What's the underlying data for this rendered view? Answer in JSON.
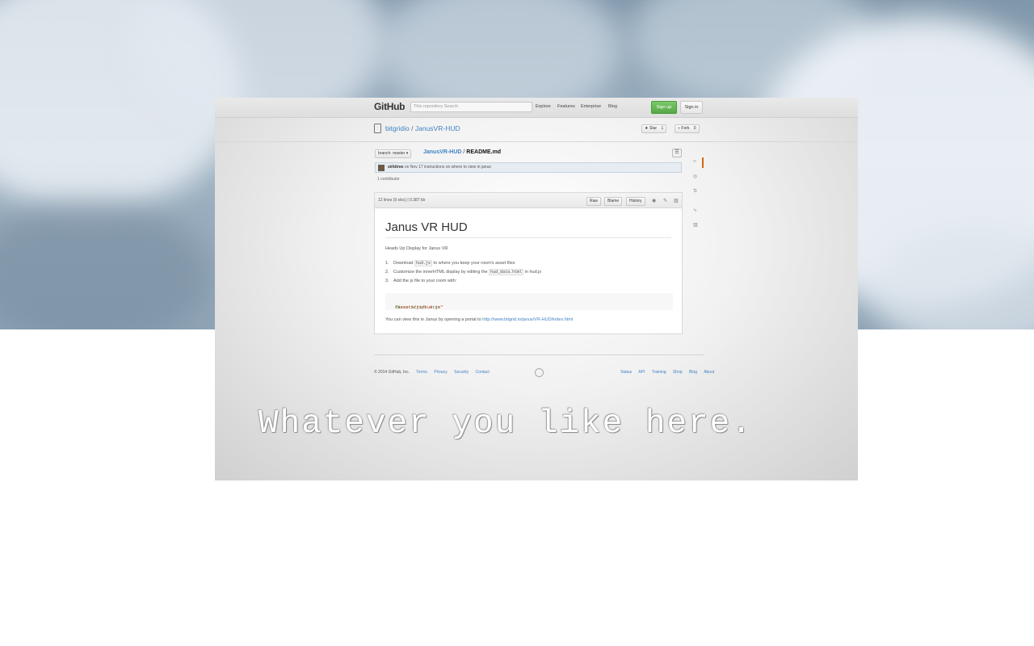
{
  "github": {
    "logo": "GitHub",
    "search_placeholder": "This repository  Search",
    "nav": [
      "Explore",
      "Features",
      "Enterprise",
      "Blog"
    ],
    "signup": "Sign up",
    "signin": "Sign in"
  },
  "repo": {
    "owner": "bitgridio",
    "separator": " / ",
    "name": "JanusVR-HUD",
    "star_label": "★ Star",
    "star_count": "1",
    "fork_label": "⑂ Fork",
    "fork_count": "0"
  },
  "file": {
    "branch_label": "branch: master ▾",
    "crumb_repo": "JanusVR-HUD",
    "crumb_sep": " / ",
    "crumb_file": "README.md",
    "commit_author": "sirkitree",
    "commit_text": "on Nov 17 instructions on where to view in janus",
    "contributors": "1 contributor",
    "info": "12 lines (9 sloc)  |  0.387 kb",
    "buttons": [
      "Raw",
      "Blame",
      "History"
    ]
  },
  "readme": {
    "title": "Janus VR HUD",
    "intro": "Heads Up Display for Janus VR",
    "steps": [
      {
        "num": "1.",
        "pre": "Download ",
        "code": "hud.js",
        "post": " to where you keep your room's asset files"
      },
      {
        "num": "2.",
        "pre": "Customize the innerHTML display by editing the ",
        "code": "hud_data.html",
        "post": " in hud.js"
      },
      {
        "num": "3.",
        "pre": "Add the js file to your room with:",
        "code": "",
        "post": ""
      }
    ],
    "code_tag_open": "<AssetScript src=",
    "code_src": "\"assets/js/hud.js\"",
    "code_tag_close": " />",
    "view_text": "You can view this in Janus by opening a portal to ",
    "view_link": "http://www.bitgrid.io/janus/VR-HUD/index.html"
  },
  "footer": {
    "copyright": "© 2014 GitHub, Inc.",
    "left_links": [
      "Terms",
      "Privacy",
      "Security",
      "Contact"
    ],
    "right_links": [
      "Status",
      "API",
      "Training",
      "Shop",
      "Blog",
      "About"
    ]
  },
  "overlay": {
    "text": "Whatever you like here."
  },
  "colors": {
    "link": "#4183c4",
    "signup": "#55a845",
    "active_tab": "#d26911"
  }
}
